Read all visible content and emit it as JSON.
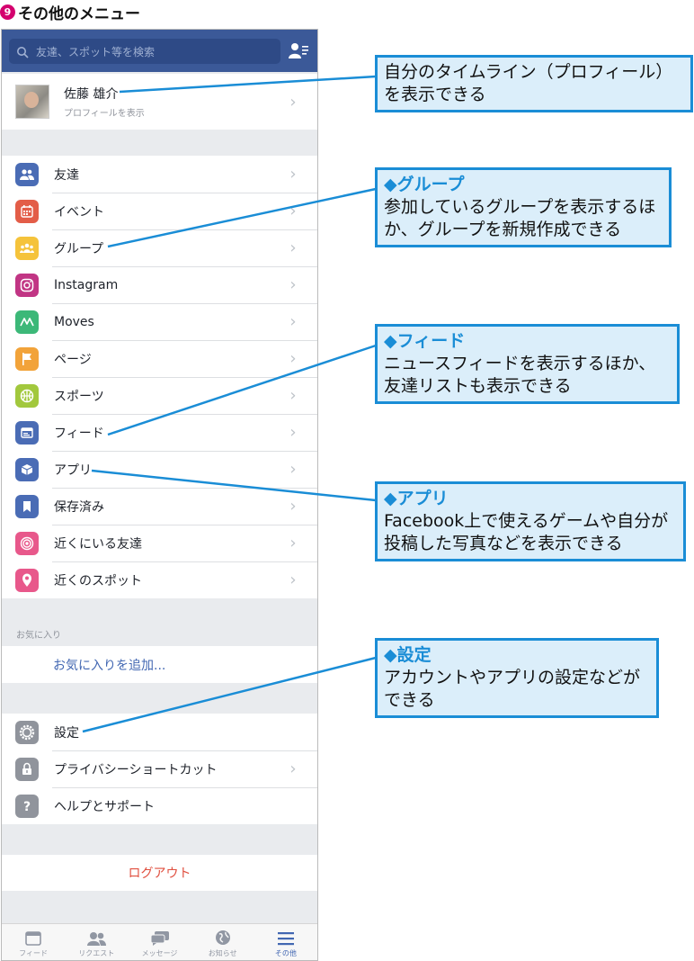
{
  "heading": {
    "number": "9",
    "title": "その他のメニュー"
  },
  "search": {
    "placeholder": "友達、スポット等を検索"
  },
  "profile": {
    "name": "佐藤 雄介",
    "sub": "プロフィールを表示"
  },
  "menu": [
    {
      "label": "友達",
      "icon": "friends-icon",
      "color": "#4a6cb5"
    },
    {
      "label": "イベント",
      "icon": "calendar-icon",
      "color": "#e35d48"
    },
    {
      "label": "グループ",
      "icon": "groups-icon",
      "color": "#f5c33b"
    },
    {
      "label": "Instagram",
      "icon": "instagram-icon",
      "color": "#c13584"
    },
    {
      "label": "Moves",
      "icon": "moves-icon",
      "color": "#3cb878"
    },
    {
      "label": "ページ",
      "icon": "flag-icon",
      "color": "#f2a33a"
    },
    {
      "label": "スポーツ",
      "icon": "sports-icon",
      "color": "#a2c83d"
    },
    {
      "label": "フィード",
      "icon": "feed-icon",
      "color": "#4a6cb5"
    },
    {
      "label": "アプリ",
      "icon": "cube-icon",
      "color": "#4a6cb5"
    },
    {
      "label": "保存済み",
      "icon": "bookmark-icon",
      "color": "#4a6cb5"
    },
    {
      "label": "近くにいる友達",
      "icon": "nearby-friends-icon",
      "color": "#e8588b"
    },
    {
      "label": "近くのスポット",
      "icon": "location-pin-icon",
      "color": "#e8588b"
    }
  ],
  "favorites": {
    "header": "お気に入り",
    "add": "お気に入りを追加..."
  },
  "settings": [
    {
      "label": "設定",
      "icon": "gear-icon",
      "color": "#90949c",
      "chevron": false
    },
    {
      "label": "プライバシーショートカット",
      "icon": "lock-icon",
      "color": "#90949c",
      "chevron": true
    },
    {
      "label": "ヘルプとサポート",
      "icon": "help-icon",
      "color": "#90949c",
      "chevron": false
    }
  ],
  "logout": "ログアウト",
  "tabs": [
    {
      "label": "フィード",
      "icon": "feed-tab-icon"
    },
    {
      "label": "リクエスト",
      "icon": "requests-tab-icon"
    },
    {
      "label": "メッセージ",
      "icon": "messages-tab-icon"
    },
    {
      "label": "お知らせ",
      "icon": "globe-tab-icon"
    },
    {
      "label": "その他",
      "icon": "menu-tab-icon",
      "active": true
    }
  ],
  "callouts": {
    "profile": {
      "title": "",
      "body": "自分のタイムライン（プロフィール）を表示できる"
    },
    "groups": {
      "title": "◆グループ",
      "body": "参加しているグループを表示するほか、グループを新規作成できる"
    },
    "feed": {
      "title": "◆フィード",
      "body": "ニュースフィードを表示するほか、友達リストも表示できる"
    },
    "apps": {
      "title": "◆アプリ",
      "body": "Facebook上で使えるゲームや自分が投稿した写真などを表示できる"
    },
    "settings": {
      "title": "◆設定",
      "body": "アカウントやアプリの設定などができる"
    }
  },
  "colors": {
    "brand": "#3b5998",
    "callout_border": "#1a8dd6",
    "callout_bg": "#dbeefa",
    "logout": "#e04f3f"
  }
}
